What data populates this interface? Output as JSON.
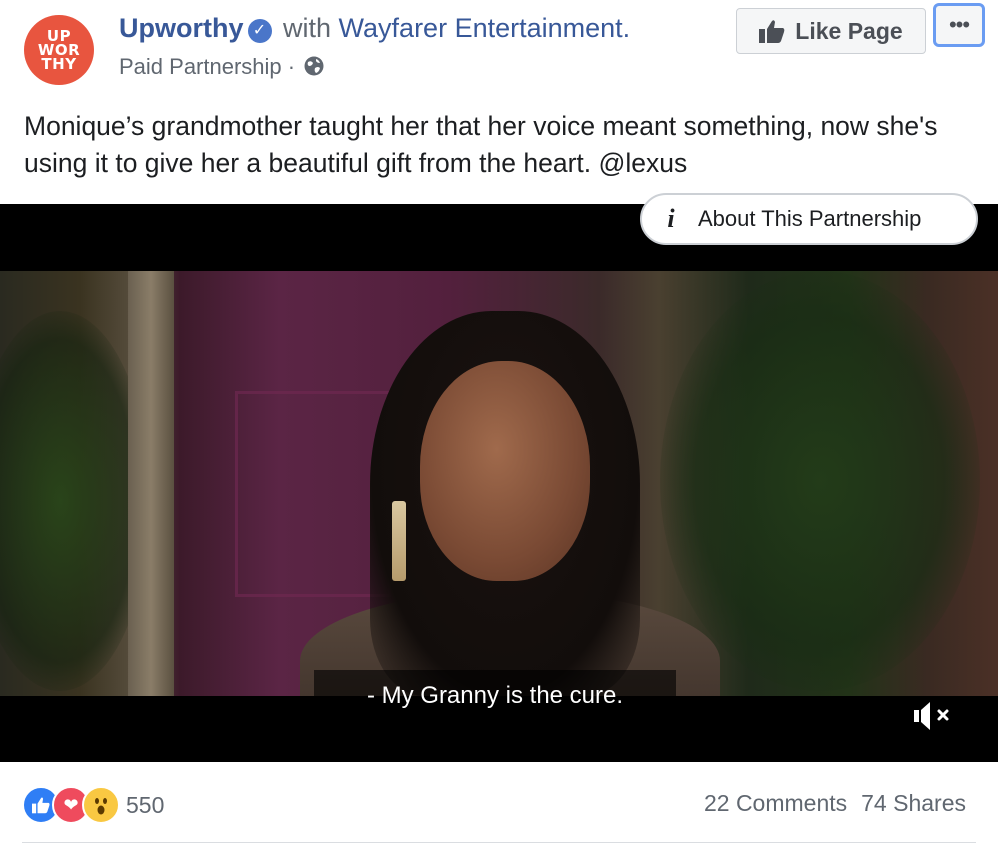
{
  "post": {
    "avatar_lines": [
      "UP",
      "WOR",
      "THY"
    ],
    "page_name": "Upworthy",
    "with_text": "with",
    "partner": "Wayfarer Entertainment.",
    "paid_label": "Paid Partnership ·",
    "globe_icon": "globe-icon",
    "like_page_label": "Like Page",
    "more_label": "•••",
    "text": "Monique’s grandmother taught her that her voice meant something, now she's using it to give her a beautiful gift from the heart. @lexus"
  },
  "video": {
    "about_partnership": "About This Partnership",
    "info_icon_glyph": "i",
    "caption": "- My Granny is the cure.",
    "mute_icon": "volume-muted-icon"
  },
  "footer": {
    "reaction_icons": [
      "like-reaction-icon",
      "love-reaction-icon",
      "wow-reaction-icon"
    ],
    "reaction_count": "550",
    "comments": "22 Comments",
    "shares": "74 Shares"
  },
  "colors": {
    "link_blue": "#385898",
    "avatar_red": "#e8553f",
    "focus_outline": "#6a9cf2",
    "like_blue": "#2f7ef5",
    "love_red": "#ef4b5d",
    "wow_yellow": "#f9c842"
  }
}
